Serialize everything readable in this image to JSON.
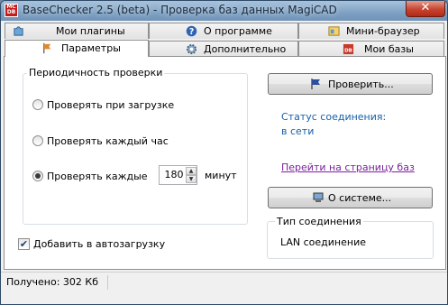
{
  "window": {
    "title": "BaseChecker 2.5 (beta) - Проверка баз данных MagiCAD",
    "close_label": "✕"
  },
  "tabs": [
    {
      "label": "Мои плагины",
      "icon": "puzzle-icon"
    },
    {
      "label": "О программе",
      "icon": "help-icon"
    },
    {
      "label": "Мини-браузер",
      "icon": "browser-icon"
    },
    {
      "label": "Параметры",
      "icon": "flag-icon",
      "active": true
    },
    {
      "label": "Дополнительно",
      "icon": "gear-icon"
    },
    {
      "label": "Мои базы",
      "icon": "database-icon"
    }
  ],
  "check_frequency": {
    "title": "Периодичность проверки",
    "options": [
      {
        "label": "Проверять при загрузке",
        "checked": false
      },
      {
        "label": "Проверять каждый час",
        "checked": false
      },
      {
        "label": "Проверять каждые",
        "checked": true
      }
    ],
    "interval_value": "180",
    "interval_unit": "минут"
  },
  "autostart": {
    "label": "Добавить в автозагрузку",
    "checked": true,
    "mark": "✔"
  },
  "actions": {
    "check_label": "Проверить...",
    "about_system_label": "О системе..."
  },
  "connection": {
    "status_label": "Статус соединения:",
    "status_value": "в сети",
    "bases_link": "Перейти на страницу баз",
    "type_title": "Тип соединения",
    "type_value": "LAN соединение"
  },
  "statusbar": {
    "text": "Получено: 302 Кб"
  },
  "colors": {
    "accent_text": "#1560a8",
    "link": "#7b1f9f",
    "title_bar": "#7ea0c2",
    "close_button": "#c64431"
  }
}
